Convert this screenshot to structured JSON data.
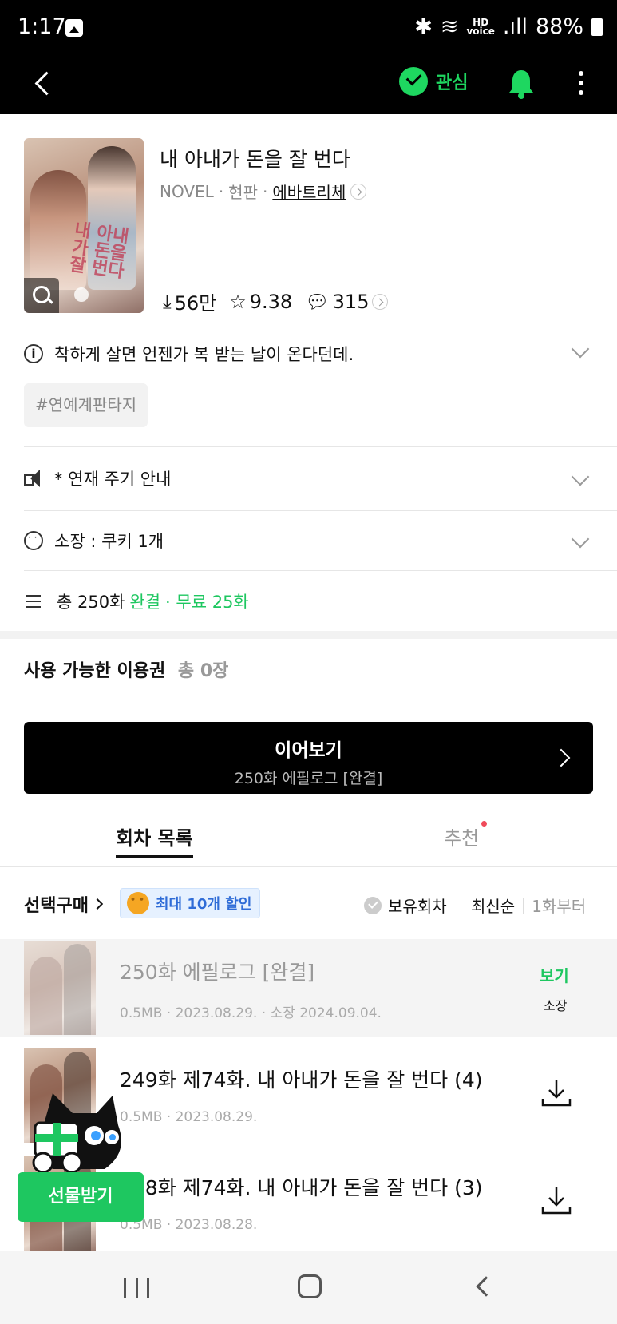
{
  "status_bar": {
    "time": "1:17",
    "battery": "88%"
  },
  "header": {
    "favorite_label": "관심"
  },
  "work": {
    "title": "내 아내가 돈을 잘 번다",
    "cover_text": "내 아내가 돈을 잘 번다",
    "category": "NOVEL",
    "genre": "현판",
    "author": "에바트리체",
    "downloads": "56만",
    "rating": "9.38",
    "comments": "315",
    "synopsis": "착하게 살면 언젠가 복 받는 날이 온다던데.",
    "tag": "#연예계판타지"
  },
  "info_rows": {
    "schedule": "* 연재 주기 안내",
    "owned": "소장 : 쿠키 1개",
    "total_prefix": "총 250화",
    "completed": "완결",
    "free": "· 무료 25화"
  },
  "passes": {
    "label": "사용 가능한 이용권",
    "count": "총 0장"
  },
  "continue": {
    "title": "이어보기",
    "subtitle": "250화 에필로그 [완결]"
  },
  "tabs": {
    "episodes": "회차 목록",
    "recommend": "추천"
  },
  "list_controls": {
    "select_buy": "선택구매",
    "discount": "최대 10개 할인",
    "owned_filter": "보유회차",
    "sort_latest": "최신순",
    "sort_first": "1화부터"
  },
  "episodes": [
    {
      "title": "250화 에필로그 [완결]",
      "meta": "0.5MB · 2023.08.29. · 소장 2024.09.04.",
      "view": "보기",
      "owned": "소장"
    },
    {
      "title": "249화 제74화. 내 아내가 돈을 잘 번다 (4)",
      "meta": "0.5MB · 2023.08.29."
    },
    {
      "title": "248화 제74화. 내 아내가 돈을 잘 번다 (3)",
      "meta": "0.5MB · 2023.08.28."
    }
  ],
  "gift": {
    "label": "선물받기"
  },
  "colors": {
    "accent": "#1ec760",
    "link_blue": "#2f6cd7",
    "background_dark": "#000000"
  }
}
